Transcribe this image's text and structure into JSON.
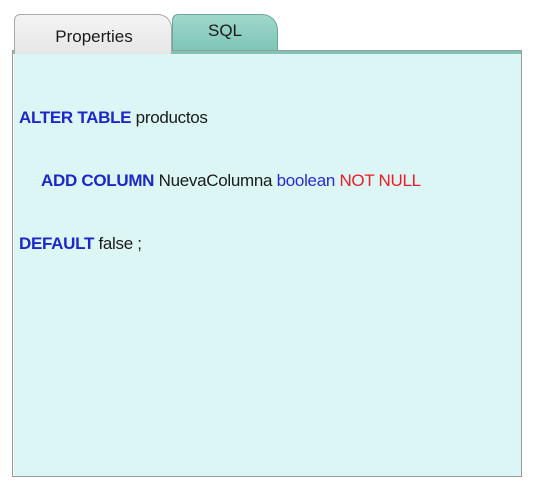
{
  "tabs": {
    "properties_label": "Properties",
    "sql_label": "SQL",
    "active": "SQL"
  },
  "colors": {
    "keyword": "#1c27c9",
    "type": "#2a2ad6",
    "constraint": "#ee1b24",
    "text": "#1a1a1a",
    "editor_background": "#dcf6f6",
    "active_tab": "#8fcfc1"
  },
  "sql": {
    "line1": {
      "keyword": "ALTER TABLE",
      "table": "productos"
    },
    "line2": {
      "keyword": "ADD COLUMN",
      "column": "NuevaColumna",
      "type": "boolean",
      "constraint": "NOT NULL"
    },
    "line3": {
      "keyword": "DEFAULT",
      "value": "false ;"
    }
  }
}
